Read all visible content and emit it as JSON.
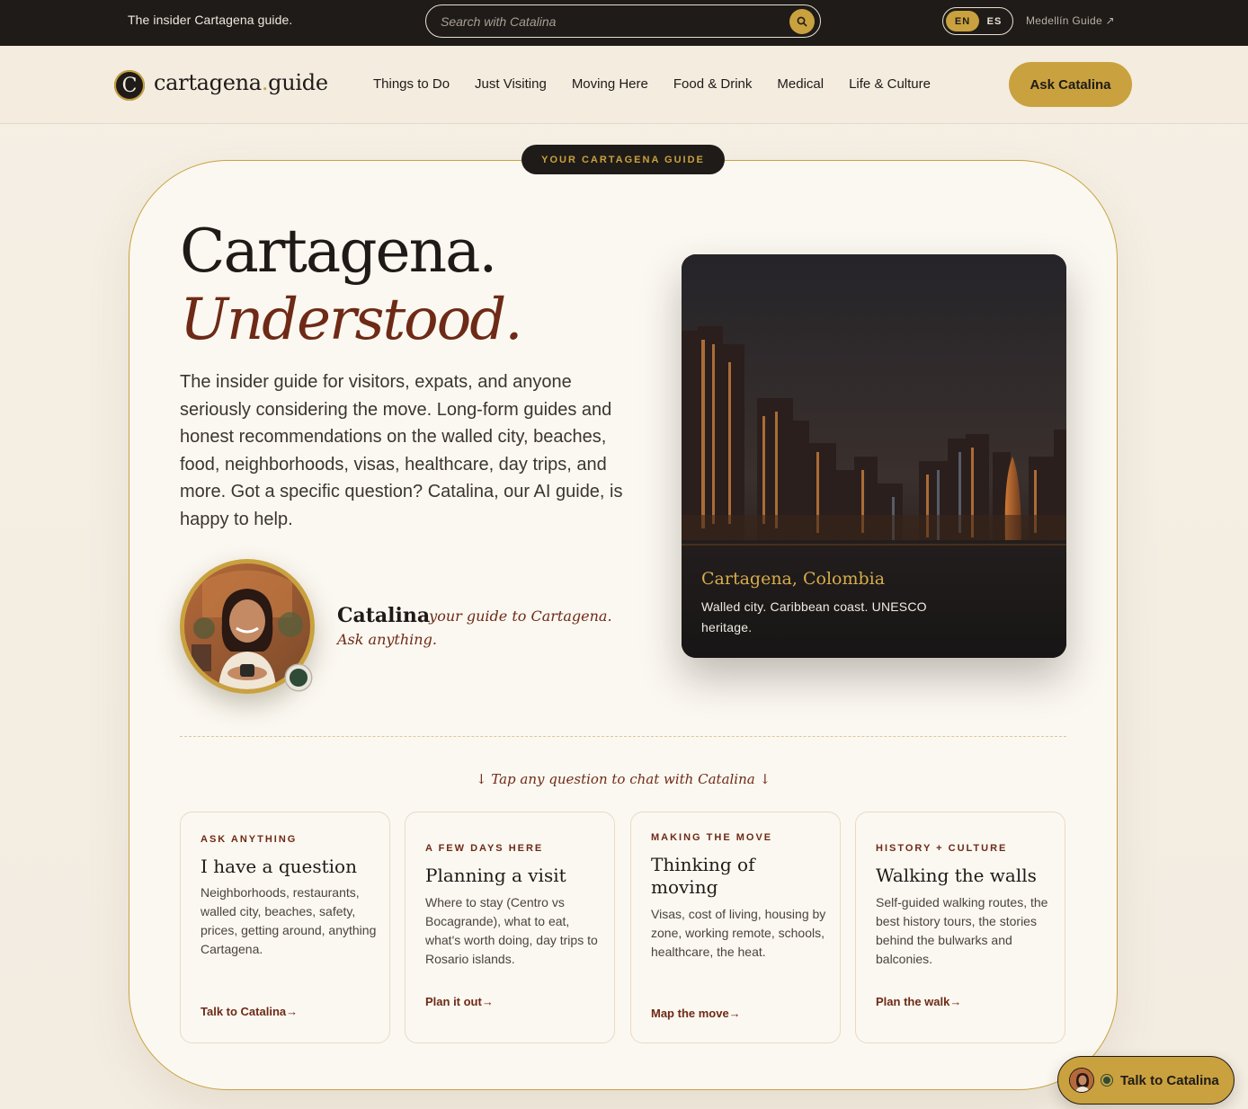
{
  "topbar": {
    "tagline": "The insider Cartagena guide.",
    "search_placeholder": "Search with Catalina",
    "lang_en": "EN",
    "lang_es": "ES",
    "sister_site": "Medellín Guide ↗"
  },
  "nav": {
    "logo_mark": "C",
    "logo_name": "cartagena",
    "logo_dot": ".",
    "logo_tld": "guide",
    "links": [
      "Things to Do",
      "Just Visiting",
      "Moving Here",
      "Food & Drink",
      "Medical",
      "Life & Culture"
    ],
    "ask_button": "Ask Catalina"
  },
  "hero": {
    "badge": "YOUR CARTAGENA GUIDE",
    "headline_line1": "Cartagena.",
    "headline_line2": "Understood.",
    "intro": "The insider guide for visitors, expats, and anyone seriously considering the move. Long-form guides and honest recommendations on the walled city, beaches, food, neighborhoods, visas, healthcare, day trips, and more. Got a specific question? Catalina, our AI guide, is happy to help.",
    "guide_name": "Catalina",
    "guide_tagline_1": "· your guide to Cartagena.",
    "guide_tagline_2": "Ask anything.",
    "photo_title": "Cartagena, Colombia",
    "photo_text": "Walled city. Caribbean coast. UNESCO heritage.",
    "tap_hint": "↓ Tap any question to chat with Catalina ↓"
  },
  "cards": [
    {
      "kicker": "ASK ANYTHING",
      "title": "I have a question",
      "desc": "Neighborhoods, restaurants, walled city, beaches, safety, prices, getting around, anything Cartagena.",
      "cta": "Talk to Catalina→"
    },
    {
      "kicker": "A FEW DAYS HERE",
      "title": "Planning a visit",
      "desc": "Where to stay (Centro vs Bocagrande), what to eat, what's worth doing, day trips to Rosario islands.",
      "cta": "Plan it out→"
    },
    {
      "kicker": "MAKING THE MOVE",
      "title": "Thinking of moving",
      "desc": "Visas, cost of living, housing by zone, working remote, schools, healthcare, the heat.",
      "cta": "Map the move→"
    },
    {
      "kicker": "HISTORY + CULTURE",
      "title": "Walking the walls",
      "desc": "Self-guided walking routes, the best history tours, the stories behind the bulwarks and balconies.",
      "cta": "Plan the walk→"
    }
  ],
  "floating": {
    "talk_label": "Talk to Catalina"
  },
  "colors": {
    "gold": "#c9a13e",
    "dark": "#1f1b18",
    "maroon": "#6e2a16",
    "cream": "#fbf8f1",
    "online_green": "#2f4a37"
  },
  "icons": {
    "search": "search-icon",
    "external": "external-link-icon",
    "status": "online-status-icon"
  }
}
